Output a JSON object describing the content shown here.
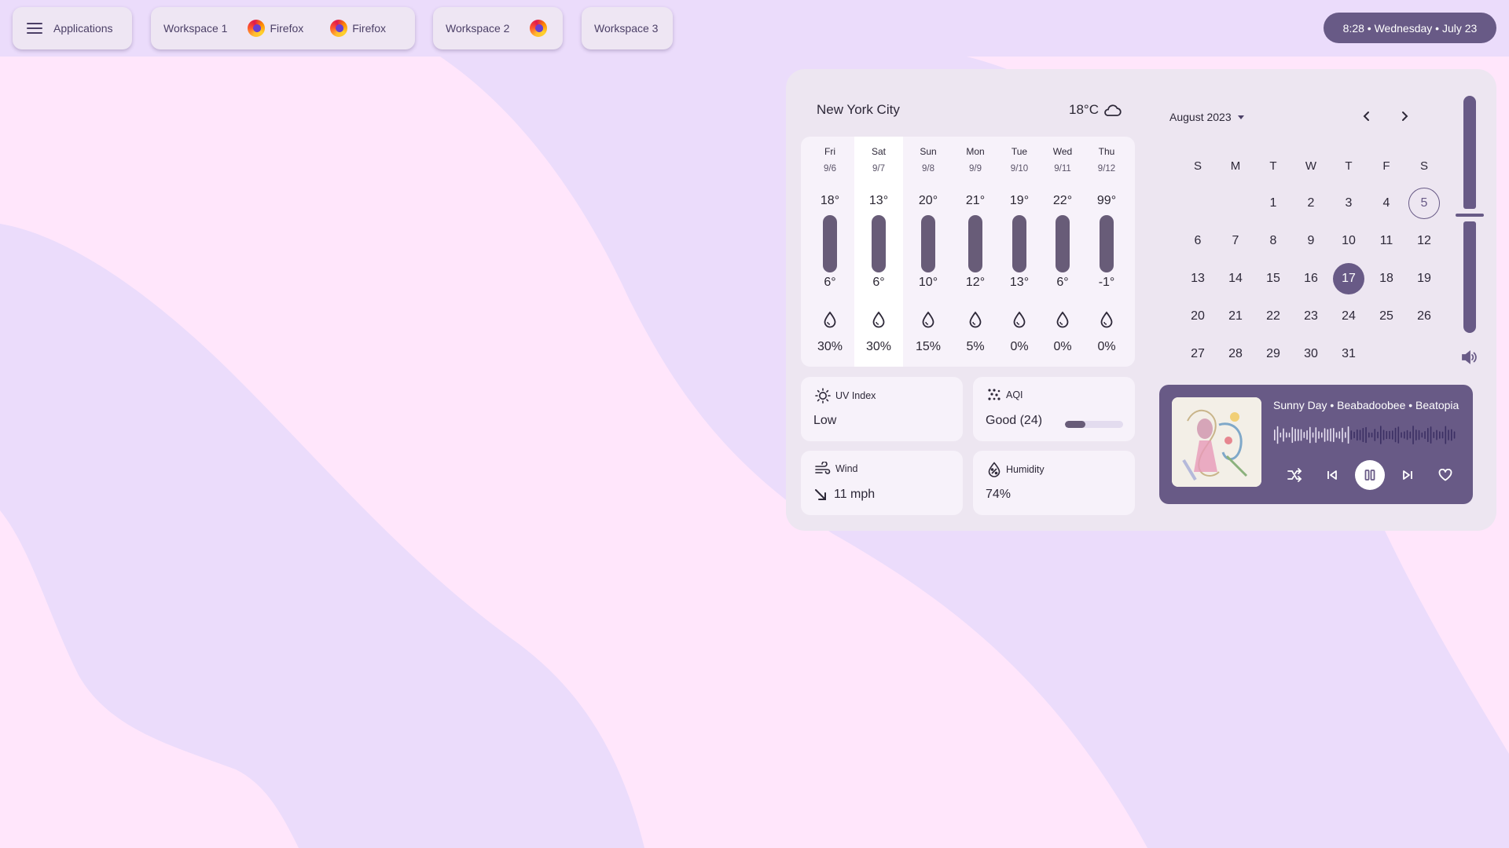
{
  "topbar": {
    "applications_label": "Applications",
    "workspaces": [
      {
        "label": "Workspace 1",
        "apps": [
          "Firefox",
          "Firefox"
        ]
      },
      {
        "label": "Workspace 2",
        "apps": [
          ""
        ]
      },
      {
        "label": "Workspace 3",
        "apps": []
      }
    ],
    "clock": "8:28 • Wednesday • July 23"
  },
  "weather": {
    "city": "New York City",
    "current_temp": "18°C",
    "current_icon": "cloud-icon",
    "days": [
      {
        "name": "Fri",
        "date": "9/6",
        "high": "18°",
        "low": "6°",
        "precip": "30%"
      },
      {
        "name": "Sat",
        "date": "9/7",
        "high": "13°",
        "low": "6°",
        "precip": "30%",
        "selected": true
      },
      {
        "name": "Sun",
        "date": "9/8",
        "high": "20°",
        "low": "10°",
        "precip": "15%"
      },
      {
        "name": "Mon",
        "date": "9/9",
        "high": "21°",
        "low": "12°",
        "precip": "5%"
      },
      {
        "name": "Tue",
        "date": "9/10",
        "high": "19°",
        "low": "13°",
        "precip": "0%"
      },
      {
        "name": "Wed",
        "date": "9/11",
        "high": "22°",
        "low": "6°",
        "precip": "0%"
      },
      {
        "name": "Thu",
        "date": "9/12",
        "high": "99°",
        "low": "-1°",
        "precip": "0%"
      }
    ],
    "uv": {
      "label": "UV Index",
      "value": "Low"
    },
    "aqi": {
      "label": "AQI",
      "value": "Good (24)",
      "level": 0.35
    },
    "wind": {
      "label": "Wind",
      "value": "11 mph"
    },
    "humidity": {
      "label": "Humidity",
      "value": "74%"
    }
  },
  "calendar": {
    "month_label": "August 2023",
    "weekdays": [
      "S",
      "M",
      "T",
      "W",
      "T",
      "F",
      "S"
    ],
    "weeks": [
      [
        "",
        "",
        "1",
        "2",
        "3",
        "4",
        "5"
      ],
      [
        "6",
        "7",
        "8",
        "9",
        "10",
        "11",
        "12"
      ],
      [
        "13",
        "14",
        "15",
        "16",
        "17",
        "18",
        "19"
      ],
      [
        "20",
        "21",
        "22",
        "23",
        "24",
        "25",
        "26"
      ],
      [
        "27",
        "28",
        "29",
        "30",
        "31",
        "",
        ""
      ]
    ],
    "today": "17",
    "marked": "5"
  },
  "volume": {
    "level": 0.5
  },
  "media": {
    "title": "Sunny Day • Beabadoobee • Beatopia",
    "state": "playing"
  },
  "colors": {
    "accent": "#685a86",
    "panel": "#ede6f1",
    "background_light": "#ffe6fb",
    "background_wave": "#ebdcfb"
  }
}
